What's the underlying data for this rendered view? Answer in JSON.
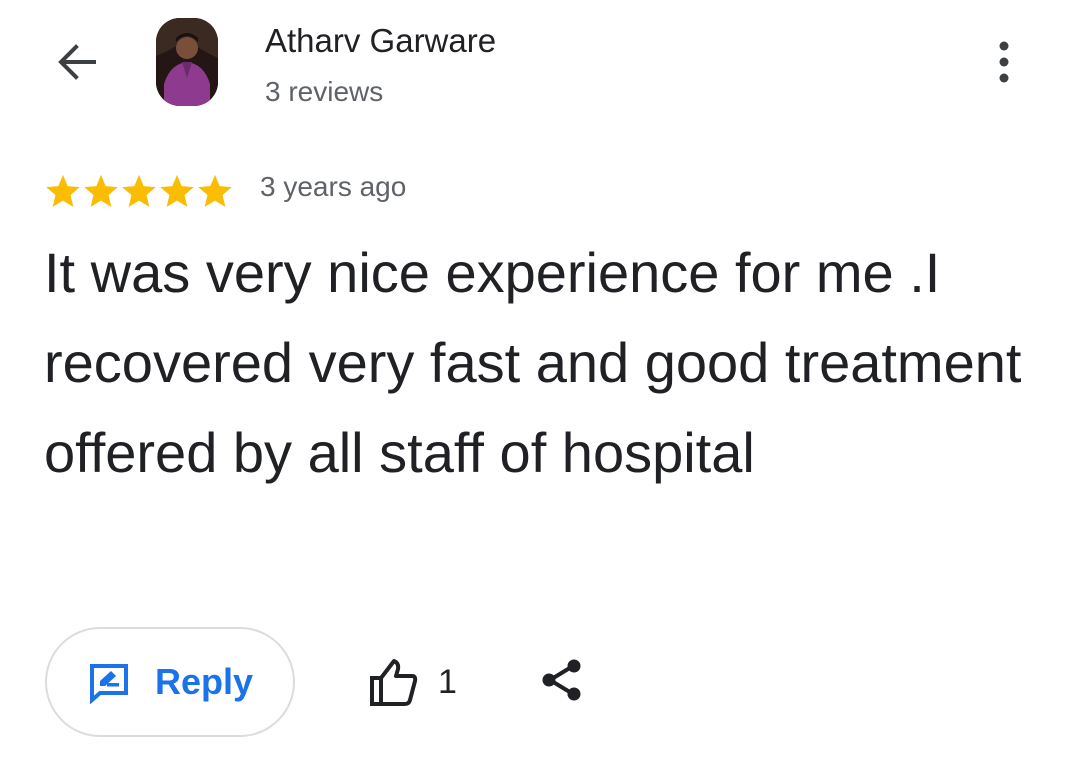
{
  "author": {
    "name": "Atharv Garware",
    "reviews_count": "3 reviews"
  },
  "review": {
    "rating": 5,
    "max_rating": 5,
    "date": "3 years ago",
    "text": "It was very nice experience for me .I recovered very fast and good treatment offered by all staff of hospital"
  },
  "actions": {
    "reply_label": "Reply",
    "like_count": "1"
  },
  "icons": {
    "back": "arrow-back-icon",
    "more": "more-vert-icon",
    "star": "star-icon",
    "reply": "reply-icon",
    "like": "thumb-up-icon",
    "share": "share-icon"
  },
  "colors": {
    "star": "#fbbc04",
    "accent": "#1a73e8",
    "text_primary": "#202124",
    "text_secondary": "#5f6368",
    "border": "#dadce0"
  }
}
